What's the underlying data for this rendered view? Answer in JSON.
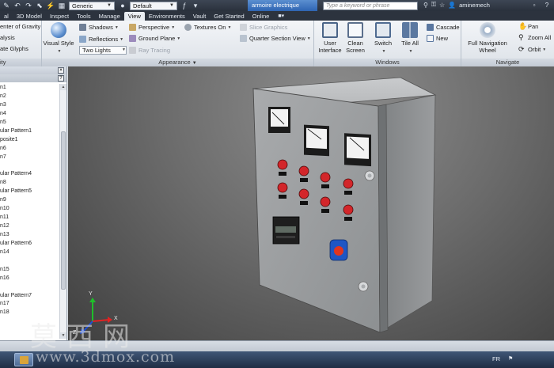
{
  "quick_access": {
    "style_value": "Generic",
    "appearance_value": "Default"
  },
  "document_title": "armoire electrique",
  "search": {
    "placeholder": "Type a keyword or phrase"
  },
  "user": {
    "name": "aminemech"
  },
  "tabs": [
    "al",
    "3D Model",
    "Inspect",
    "Tools",
    "Manage",
    "View",
    "Environments",
    "Vault",
    "Get Started",
    "Online"
  ],
  "active_tab": "View",
  "ribbon": {
    "visibility": {
      "items": [
        "enter of Gravity",
        "alysis",
        "ate Glyphs"
      ],
      "label": "ity"
    },
    "appearance": {
      "visual_style": "Visual Style",
      "shadows": "Shadows",
      "reflections": "Reflections",
      "lighting": "Two Lights",
      "perspective": "Perspective",
      "ground_plane": "Ground Plane",
      "ray_tracing": "Ray Tracing",
      "textures_on": "Textures On",
      "slice_graphics": "Slice Graphics",
      "quarter_section_view": "Quarter Section View",
      "label": "Appearance"
    },
    "windows": {
      "user_interface": [
        "User",
        "Interface"
      ],
      "clean_screen": [
        "Clean",
        "Screen"
      ],
      "switch": "Switch",
      "tile_all": "Tile All",
      "cascade": "Cascade",
      "new": "New",
      "label": "Windows"
    },
    "navigate": {
      "full_nav_wheel": [
        "Full Navigation",
        "Wheel"
      ],
      "pan": "Pan",
      "zoom_all": "Zoom All",
      "orbit": "Orbit",
      "label": "Navigate"
    }
  },
  "browser": {
    "items": [
      "n1",
      "n2",
      "n3",
      "n4",
      "n5",
      "ular Pattern1",
      "posite1",
      "n6",
      "n7",
      "",
      "ular Pattern4",
      "n8",
      "ular Pattern5",
      "n9",
      "n10",
      "n11",
      "n12",
      "n13",
      "ular Pattern6",
      "n14",
      "",
      "n15",
      "n16",
      "",
      "ular Pattern7",
      "n17",
      "n18"
    ]
  },
  "axis": {
    "x": "X",
    "y": "Y",
    "z": "Z"
  },
  "taskbar": {
    "language": "FR"
  },
  "watermark": {
    "chinese": "莫西网",
    "url": "www.3dmox.com"
  }
}
